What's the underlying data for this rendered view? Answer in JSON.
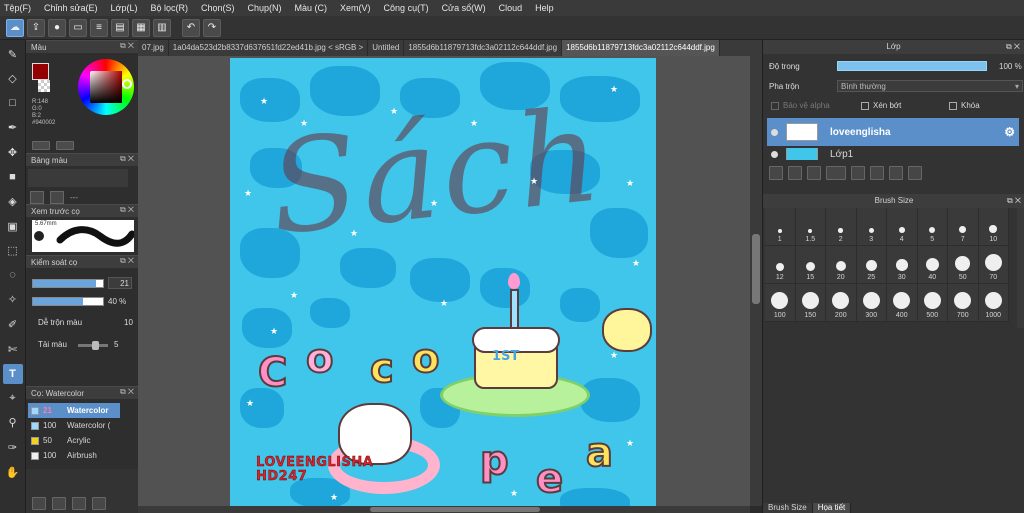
{
  "menu": [
    "Tệp(F)",
    "Chỉnh sửa(E)",
    "Lớp(L)",
    "Bộ lọc(R)",
    "Chọn(S)",
    "Chụp(N)",
    "Màu (C)",
    "Xem(V)",
    "Công cụ(T)",
    "Cửa sổ(W)",
    "Cloud",
    "Help"
  ],
  "doc_tabs": [
    {
      "label": "07.jpg",
      "selected": false
    },
    {
      "label": "1a04da523d2b8337d637651fd22ed41b.jpg < sRGB >",
      "selected": false
    },
    {
      "label": "Untitled",
      "selected": false
    },
    {
      "label": "1855d6b11879713fdc3a02112c644ddf.jpg",
      "selected": false
    },
    {
      "label": "1855d6b11879713fdc3a02112c644ddf.jpg",
      "selected": true
    }
  ],
  "color_panel": {
    "title": "Màu",
    "fg_color": "#940002",
    "r": "R:148",
    "g": "G:0",
    "b": "B:2",
    "hex": "#940002"
  },
  "palette_panel": {
    "title": "Bảng màu",
    "text": "---"
  },
  "preview_panel": {
    "title": "Xem trước cọ",
    "size": "5.67mm"
  },
  "brush_control": {
    "title": "Kiểm soát cọ",
    "size_value": "21",
    "size_fraction": 0.9,
    "opacity_value": "40",
    "opacity_unit": "%",
    "opacity_fraction": 0.72,
    "blend_label": "Dễ trộn màu",
    "blend_value": "10",
    "mix_label": "Tải màu",
    "mix_value": "5"
  },
  "brush_list": {
    "title": "Cọ: Watercolor",
    "items": [
      {
        "size": "21",
        "name": "Watercolor",
        "color": "#9fd8ff",
        "selected": true
      },
      {
        "size": "100",
        "name": "Watercolor (",
        "color": "#9fd8ff",
        "selected": false
      },
      {
        "size": "50",
        "name": "Acrylic",
        "color": "#f2d21b",
        "selected": false
      },
      {
        "size": "100",
        "name": "Airbrush",
        "color": "#f0f0f0",
        "selected": false
      }
    ]
  },
  "canvas": {
    "text_sach": "Sách",
    "cake_text": "1ST",
    "watermark_line1": "LOVEENGLISHA",
    "watermark_line2": "HD247"
  },
  "layer_panel": {
    "title": "Lớp",
    "opacity_label": "Độ trong",
    "opacity_value": "100 %",
    "blend_label": "Pha trộn",
    "blend_value": "Bình thường",
    "protect_alpha": "Bảo vệ alpha",
    "clipping": "Xén bớt",
    "lock": "Khóa",
    "layers": [
      {
        "name": "loveenglisha",
        "selected": true
      },
      {
        "name": "Lớp1",
        "selected": false
      }
    ]
  },
  "brush_size_panel": {
    "title": "Brush Size",
    "sizes": [
      "1",
      "1.5",
      "2",
      "3",
      "4",
      "5",
      "7",
      "10",
      "12",
      "15",
      "20",
      "25",
      "30",
      "40",
      "50",
      "70",
      "100",
      "150",
      "200",
      "300",
      "400",
      "500",
      "700",
      "1000"
    ]
  },
  "right_tabs": [
    "Brush Size",
    "Họa tiết"
  ]
}
